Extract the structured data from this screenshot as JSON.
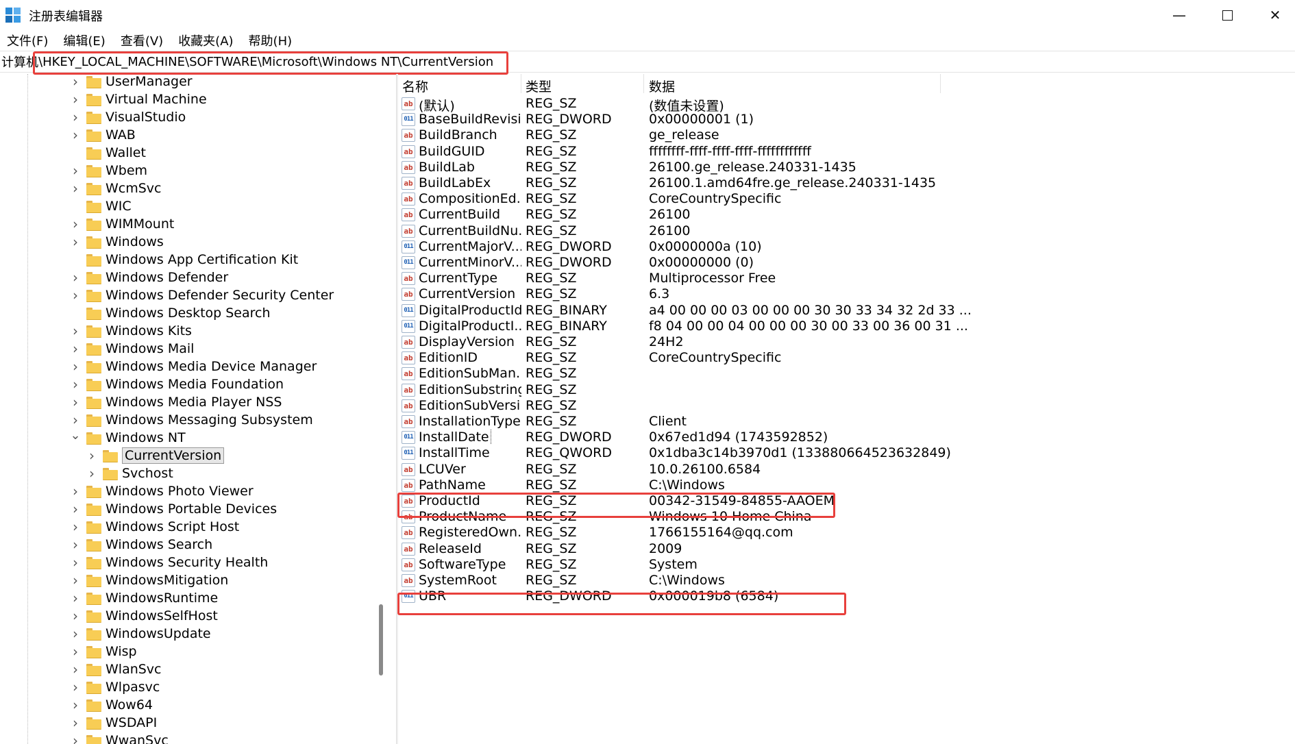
{
  "window": {
    "title": "注册表编辑器",
    "icon": "registry-editor-icon",
    "minimize_glyph": "—",
    "close_glyph": "✕"
  },
  "menu": [
    "文件(F)",
    "编辑(E)",
    "查看(V)",
    "收藏夹(A)",
    "帮助(H)"
  ],
  "address": {
    "prefix": "计算机",
    "path": "\\HKEY_LOCAL_MACHINE\\SOFTWARE\\Microsoft\\Windows NT\\CurrentVersion"
  },
  "tree": {
    "items": [
      {
        "label": "UserManager",
        "level": 0,
        "expand": "collapsed"
      },
      {
        "label": "Virtual Machine",
        "level": 0,
        "expand": "collapsed"
      },
      {
        "label": "VisualStudio",
        "level": 0,
        "expand": "collapsed"
      },
      {
        "label": "WAB",
        "level": 0,
        "expand": "collapsed"
      },
      {
        "label": "Wallet",
        "level": 0,
        "expand": "none"
      },
      {
        "label": "Wbem",
        "level": 0,
        "expand": "collapsed"
      },
      {
        "label": "WcmSvc",
        "level": 0,
        "expand": "collapsed"
      },
      {
        "label": "WIC",
        "level": 0,
        "expand": "none"
      },
      {
        "label": "WIMMount",
        "level": 0,
        "expand": "collapsed"
      },
      {
        "label": "Windows",
        "level": 0,
        "expand": "collapsed"
      },
      {
        "label": "Windows App Certification Kit",
        "level": 0,
        "expand": "none"
      },
      {
        "label": "Windows Defender",
        "level": 0,
        "expand": "collapsed"
      },
      {
        "label": "Windows Defender Security Center",
        "level": 0,
        "expand": "collapsed"
      },
      {
        "label": "Windows Desktop Search",
        "level": 0,
        "expand": "none"
      },
      {
        "label": "Windows Kits",
        "level": 0,
        "expand": "collapsed"
      },
      {
        "label": "Windows Mail",
        "level": 0,
        "expand": "collapsed"
      },
      {
        "label": "Windows Media Device Manager",
        "level": 0,
        "expand": "collapsed"
      },
      {
        "label": "Windows Media Foundation",
        "level": 0,
        "expand": "collapsed"
      },
      {
        "label": "Windows Media Player NSS",
        "level": 0,
        "expand": "collapsed"
      },
      {
        "label": "Windows Messaging Subsystem",
        "level": 0,
        "expand": "collapsed"
      },
      {
        "label": "Windows NT",
        "level": 0,
        "expand": "expanded"
      },
      {
        "label": "CurrentVersion",
        "level": 1,
        "expand": "collapsed",
        "selected": true
      },
      {
        "label": "Svchost",
        "level": 1,
        "expand": "collapsed"
      },
      {
        "label": "Windows Photo Viewer",
        "level": 0,
        "expand": "collapsed"
      },
      {
        "label": "Windows Portable Devices",
        "level": 0,
        "expand": "collapsed"
      },
      {
        "label": "Windows Script Host",
        "level": 0,
        "expand": "collapsed"
      },
      {
        "label": "Windows Search",
        "level": 0,
        "expand": "collapsed"
      },
      {
        "label": "Windows Security Health",
        "level": 0,
        "expand": "collapsed"
      },
      {
        "label": "WindowsMitigation",
        "level": 0,
        "expand": "collapsed"
      },
      {
        "label": "WindowsRuntime",
        "level": 0,
        "expand": "collapsed"
      },
      {
        "label": "WindowsSelfHost",
        "level": 0,
        "expand": "collapsed"
      },
      {
        "label": "WindowsUpdate",
        "level": 0,
        "expand": "collapsed"
      },
      {
        "label": "Wisp",
        "level": 0,
        "expand": "collapsed"
      },
      {
        "label": "WlanSvc",
        "level": 0,
        "expand": "collapsed"
      },
      {
        "label": "Wlpasvc",
        "level": 0,
        "expand": "collapsed"
      },
      {
        "label": "Wow64",
        "level": 0,
        "expand": "collapsed"
      },
      {
        "label": "WSDAPI",
        "level": 0,
        "expand": "collapsed"
      },
      {
        "label": "WwanSvc",
        "level": 0,
        "expand": "collapsed"
      }
    ]
  },
  "list": {
    "headers": {
      "name": "名称",
      "type": "类型",
      "data": "数据"
    },
    "rows": [
      {
        "name": "(默认)",
        "type": "REG_SZ",
        "data": "(数值未设置)",
        "icon": "ab"
      },
      {
        "name": "BaseBuildRevisi...",
        "type": "REG_DWORD",
        "data": "0x00000001 (1)",
        "icon": "bin"
      },
      {
        "name": "BuildBranch",
        "type": "REG_SZ",
        "data": "ge_release",
        "icon": "ab"
      },
      {
        "name": "BuildGUID",
        "type": "REG_SZ",
        "data": "ffffffff-ffff-ffff-ffff-ffffffffffff",
        "icon": "ab"
      },
      {
        "name": "BuildLab",
        "type": "REG_SZ",
        "data": "26100.ge_release.240331-1435",
        "icon": "ab"
      },
      {
        "name": "BuildLabEx",
        "type": "REG_SZ",
        "data": "26100.1.amd64fre.ge_release.240331-1435",
        "icon": "ab"
      },
      {
        "name": "CompositionEd...",
        "type": "REG_SZ",
        "data": "CoreCountrySpecific",
        "icon": "ab"
      },
      {
        "name": "CurrentBuild",
        "type": "REG_SZ",
        "data": "26100",
        "icon": "ab"
      },
      {
        "name": "CurrentBuildNu...",
        "type": "REG_SZ",
        "data": "26100",
        "icon": "ab"
      },
      {
        "name": "CurrentMajorV...",
        "type": "REG_DWORD",
        "data": "0x0000000a (10)",
        "icon": "bin"
      },
      {
        "name": "CurrentMinorV...",
        "type": "REG_DWORD",
        "data": "0x00000000 (0)",
        "icon": "bin"
      },
      {
        "name": "CurrentType",
        "type": "REG_SZ",
        "data": "Multiprocessor Free",
        "icon": "ab"
      },
      {
        "name": "CurrentVersion",
        "type": "REG_SZ",
        "data": "6.3",
        "icon": "ab"
      },
      {
        "name": "DigitalProductId",
        "type": "REG_BINARY",
        "data": "a4 00 00 00 03 00 00 00 30 30 33 34 32 2d 33 ...",
        "icon": "bin"
      },
      {
        "name": "DigitalProductI...",
        "type": "REG_BINARY",
        "data": "f8 04 00 00 04 00 00 00 30 00 33 00 36 00 31 ...",
        "icon": "bin"
      },
      {
        "name": "DisplayVersion",
        "type": "REG_SZ",
        "data": "24H2",
        "icon": "ab"
      },
      {
        "name": "EditionID",
        "type": "REG_SZ",
        "data": "CoreCountrySpecific",
        "icon": "ab"
      },
      {
        "name": "EditionSubMan...",
        "type": "REG_SZ",
        "data": "",
        "icon": "ab"
      },
      {
        "name": "EditionSubstring",
        "type": "REG_SZ",
        "data": "",
        "icon": "ab"
      },
      {
        "name": "EditionSubVersi...",
        "type": "REG_SZ",
        "data": "",
        "icon": "ab"
      },
      {
        "name": "InstallationType",
        "type": "REG_SZ",
        "data": "Client",
        "icon": "ab"
      },
      {
        "name": "InstallDate",
        "type": "REG_DWORD",
        "data": "0x67ed1d94 (1743592852)",
        "icon": "bin",
        "focused": true
      },
      {
        "name": "InstallTime",
        "type": "REG_QWORD",
        "data": "0x1dba3c14b3970d1 (133880664523632849)",
        "icon": "bin"
      },
      {
        "name": "LCUVer",
        "type": "REG_SZ",
        "data": "10.0.26100.6584",
        "icon": "ab"
      },
      {
        "name": "PathName",
        "type": "REG_SZ",
        "data": "C:\\Windows",
        "icon": "ab"
      },
      {
        "name": "ProductId",
        "type": "REG_SZ",
        "data": "00342-31549-84855-AAOEM",
        "icon": "ab"
      },
      {
        "name": "ProductName",
        "type": "REG_SZ",
        "data": "Windows 10 Home China",
        "icon": "ab"
      },
      {
        "name": "RegisteredOwn...",
        "type": "REG_SZ",
        "data": "1766155164@qq.com",
        "icon": "ab"
      },
      {
        "name": "ReleaseId",
        "type": "REG_SZ",
        "data": "2009",
        "icon": "ab"
      },
      {
        "name": "SoftwareType",
        "type": "REG_SZ",
        "data": "System",
        "icon": "ab"
      },
      {
        "name": "SystemRoot",
        "type": "REG_SZ",
        "data": "C:\\Windows",
        "icon": "ab"
      },
      {
        "name": "UBR",
        "type": "REG_DWORD",
        "data": "0x000019b8 (6584)",
        "icon": "bin"
      }
    ]
  },
  "icon_glyphs": {
    "ab": "ab",
    "bin": "011"
  },
  "colors": {
    "highlight": "#e8403c",
    "folder": "#f8cd55"
  }
}
